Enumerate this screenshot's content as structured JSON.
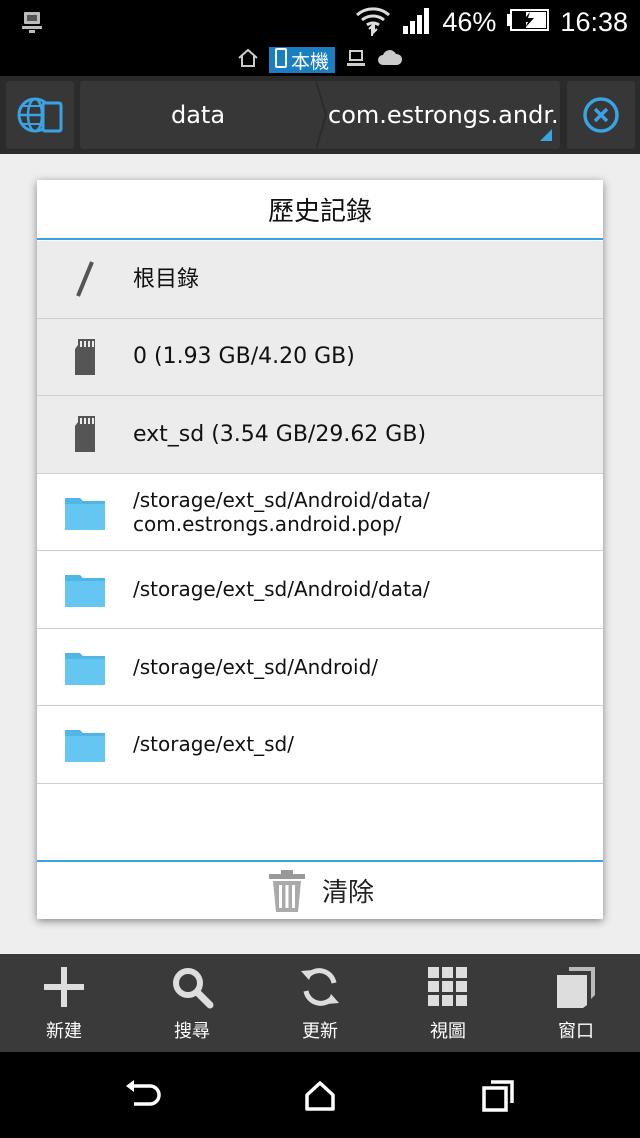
{
  "status_bar": {
    "battery_percent": "46%",
    "time": "16:38",
    "icons": [
      "usb-debug-icon",
      "wifi-icon",
      "signal-icon",
      "battery-charging-icon"
    ]
  },
  "location_strip": {
    "local_label": "本機",
    "icons": [
      "home-icon",
      "phone-icon",
      "computer-icon",
      "cloud-icon"
    ]
  },
  "toolbar": {
    "breadcrumbs": [
      "data",
      "com.estrongs.andr..."
    ],
    "accent_color": "#3aa3e3"
  },
  "dialog": {
    "title": "歷史記錄",
    "items": [
      {
        "icon": "root-slash-icon",
        "label": "根目錄"
      },
      {
        "icon": "sd-card-icon",
        "label": "0 (1.93 GB/4.20 GB)"
      },
      {
        "icon": "sd-card-icon",
        "label": "ext_sd (3.54 GB/29.62 GB)"
      },
      {
        "icon": "folder-icon",
        "label": "/storage/ext_sd/Android/data/\ncom.estrongs.android.pop/"
      },
      {
        "icon": "folder-icon",
        "label": "/storage/ext_sd/Android/data/"
      },
      {
        "icon": "folder-icon",
        "label": "/storage/ext_sd/Android/"
      },
      {
        "icon": "folder-icon",
        "label": "/storage/ext_sd/"
      }
    ],
    "clear_label": "清除"
  },
  "bottom_bar": {
    "items": [
      {
        "icon": "plus-icon",
        "label": "新建"
      },
      {
        "icon": "search-icon",
        "label": "搜尋"
      },
      {
        "icon": "refresh-icon",
        "label": "更新"
      },
      {
        "icon": "grid-view-icon",
        "label": "視圖"
      },
      {
        "icon": "windows-icon",
        "label": "窗口"
      }
    ]
  },
  "nav_bar": {
    "icons": [
      "back-icon",
      "home-icon",
      "recents-icon"
    ]
  }
}
